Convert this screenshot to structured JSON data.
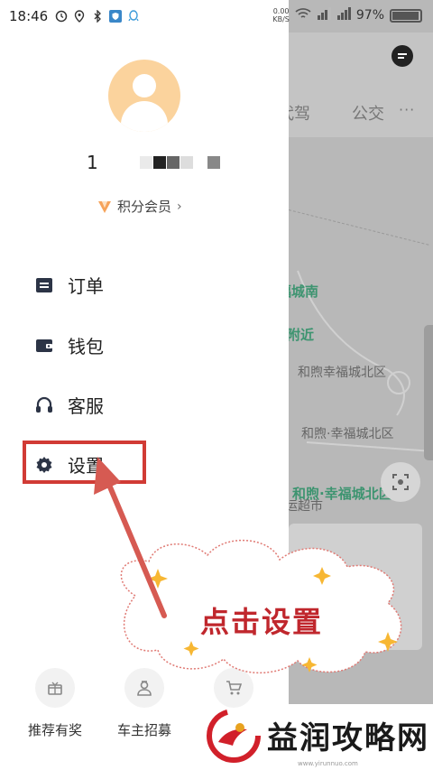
{
  "status_bar": {
    "time": "18:46",
    "net_speed_value": "0.00",
    "net_speed_unit": "KB/S",
    "battery": "97%",
    "battery_level": 0.97
  },
  "map": {
    "tab_drive": "代驾",
    "tab_bus": "公交",
    "more": "···",
    "poi_green_1": "福城南",
    "poi_green_2": "附近",
    "poi_1": "和煦幸福城北区",
    "poi_2": "和煦·幸福城北区",
    "poi_green_3": "和煦·幸福城北区",
    "poi_3": "运超市"
  },
  "drawer": {
    "phone_prefix": "1",
    "member_label": "积分会员",
    "member_chevron": "›",
    "menu": [
      {
        "label": "订单",
        "icon": "order-icon"
      },
      {
        "label": "钱包",
        "icon": "wallet-icon"
      },
      {
        "label": "客服",
        "icon": "headset-icon"
      },
      {
        "label": "设置",
        "icon": "gear-icon"
      }
    ],
    "bottom": [
      {
        "label": "推荐有奖",
        "icon": "gift-icon"
      },
      {
        "label": "车主招募",
        "icon": "driver-icon"
      },
      {
        "label": "",
        "icon": "cart-icon"
      }
    ]
  },
  "annotation": {
    "callout": "点击设置",
    "color": "#d13b35"
  },
  "watermark": {
    "text": "益润攻略网",
    "url": "www.yirunnuo.com"
  }
}
